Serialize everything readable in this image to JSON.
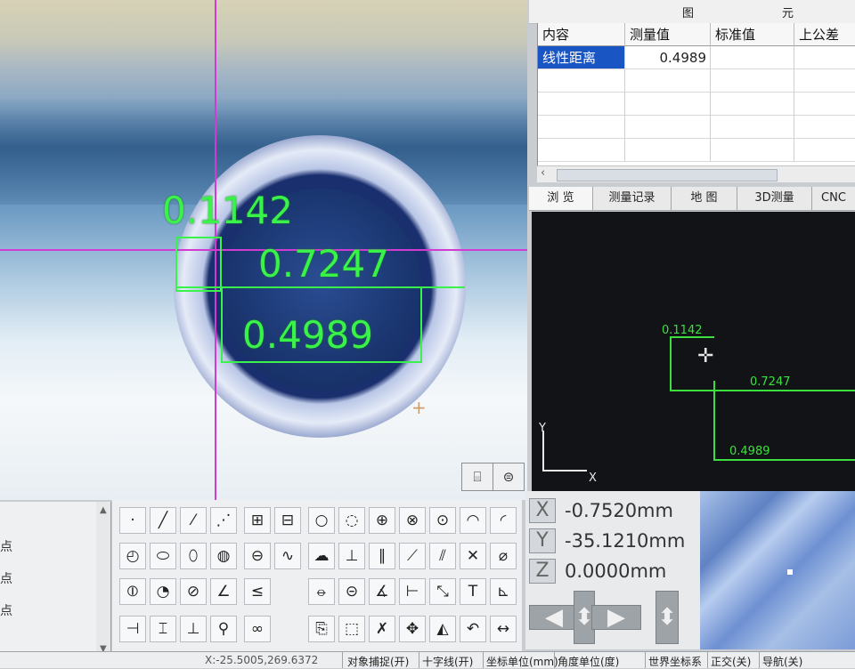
{
  "camera": {
    "measurements": [
      {
        "value": "0.1142"
      },
      {
        "value": "0.7247"
      },
      {
        "value": "0.4989"
      }
    ]
  },
  "panel_title": {
    "left": "图",
    "right": "元"
  },
  "table": {
    "headers": [
      "内容",
      "测量值",
      "标准值",
      "上公差"
    ],
    "rows": [
      {
        "name": "线性距离",
        "measured": "0.4989",
        "standard": "",
        "upper_tol": ""
      }
    ]
  },
  "tabs": [
    "浏 览",
    "测量记录",
    "地 图",
    "3D测量",
    "CNC"
  ],
  "graph": {
    "labels": {
      "m1": "0.1142",
      "m2": "0.7247",
      "m3": "0.4989"
    },
    "axis_y": "Y",
    "axis_x": "X"
  },
  "left_labels": [
    "点",
    "点",
    "点"
  ],
  "coords": {
    "x_label": "X",
    "y_label": "Y",
    "z_label": "Z",
    "x_value": "-0.7520mm",
    "y_value": "-35.1210mm",
    "z_value": "0.0000mm"
  },
  "status": {
    "left_text": "X:-25.5005,269.6372",
    "items": [
      "对象捕捉(开)",
      "十字线(开)",
      "坐标单位(mm)",
      "角度单位(度)",
      "世界坐标系",
      "正交(关)",
      "导航(关)"
    ]
  },
  "colors": {
    "measure_green": "#39f24a",
    "crosshair": "#d23bd2",
    "graph_bg": "#121316"
  }
}
